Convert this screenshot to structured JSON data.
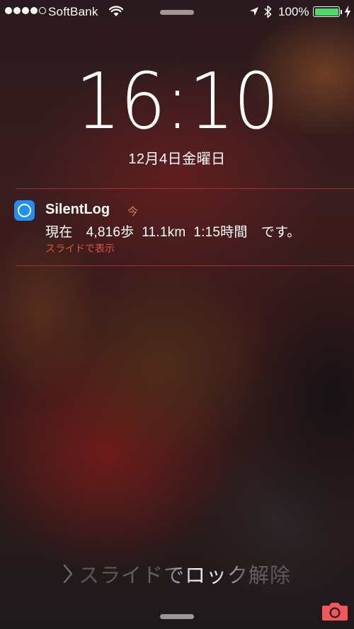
{
  "status_bar": {
    "signal_bars_filled": 4,
    "signal_bars_total": 5,
    "carrier": "SoftBank",
    "battery_percent": "100%",
    "battery_level": 1.0,
    "battery_color": "#4cd964",
    "icons": [
      "wifi-icon",
      "location-icon",
      "bluetooth-icon",
      "battery-icon",
      "charging-icon"
    ]
  },
  "lock_screen": {
    "time": "16:10",
    "date": "12月4日金曜日"
  },
  "notification": {
    "app_icon": "silentlog-app-icon",
    "app_icon_color": "#1e90f5",
    "app_name": "SilentLog",
    "time": "今",
    "body": "現在　4,816歩  11.1km  1:15時間　です。",
    "action": "スライドで表示",
    "accent_color": "#e05540"
  },
  "bottom": {
    "unlock_text": "スライドでロック解除",
    "camera_icon": "camera-icon",
    "camera_color": "#f0585a"
  }
}
